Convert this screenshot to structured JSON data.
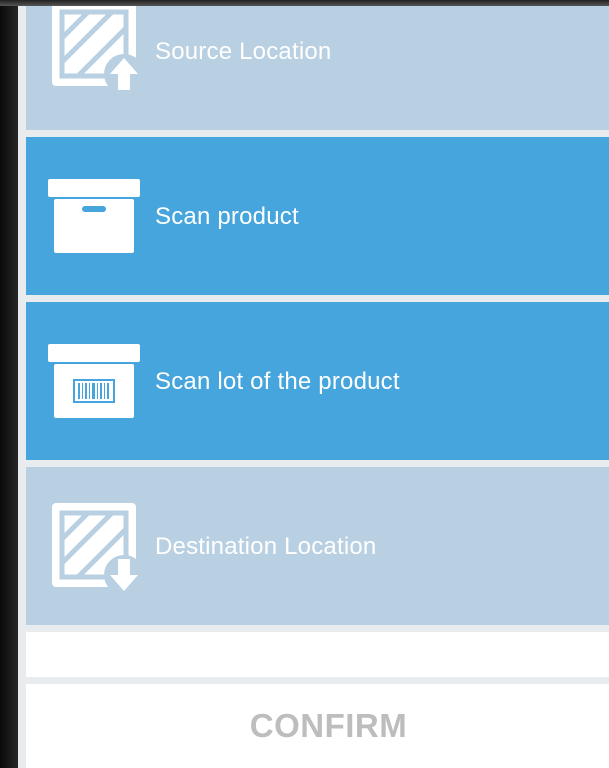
{
  "steps": [
    {
      "label": "Source Location",
      "icon": "location-upload-icon",
      "state": "inactive"
    },
    {
      "label": "Scan product",
      "icon": "box-icon",
      "state": "active"
    },
    {
      "label": "Scan lot of the product",
      "icon": "barcode-box-icon",
      "state": "active"
    },
    {
      "label": "Destination Location",
      "icon": "location-download-icon",
      "state": "inactive"
    }
  ],
  "confirm": {
    "label": "CONFIRM"
  },
  "colors": {
    "active_row": "#45a5dc",
    "inactive_row": "#b8d0e2",
    "divider": "#e9ecee",
    "confirm_text": "#bdbdbd"
  }
}
